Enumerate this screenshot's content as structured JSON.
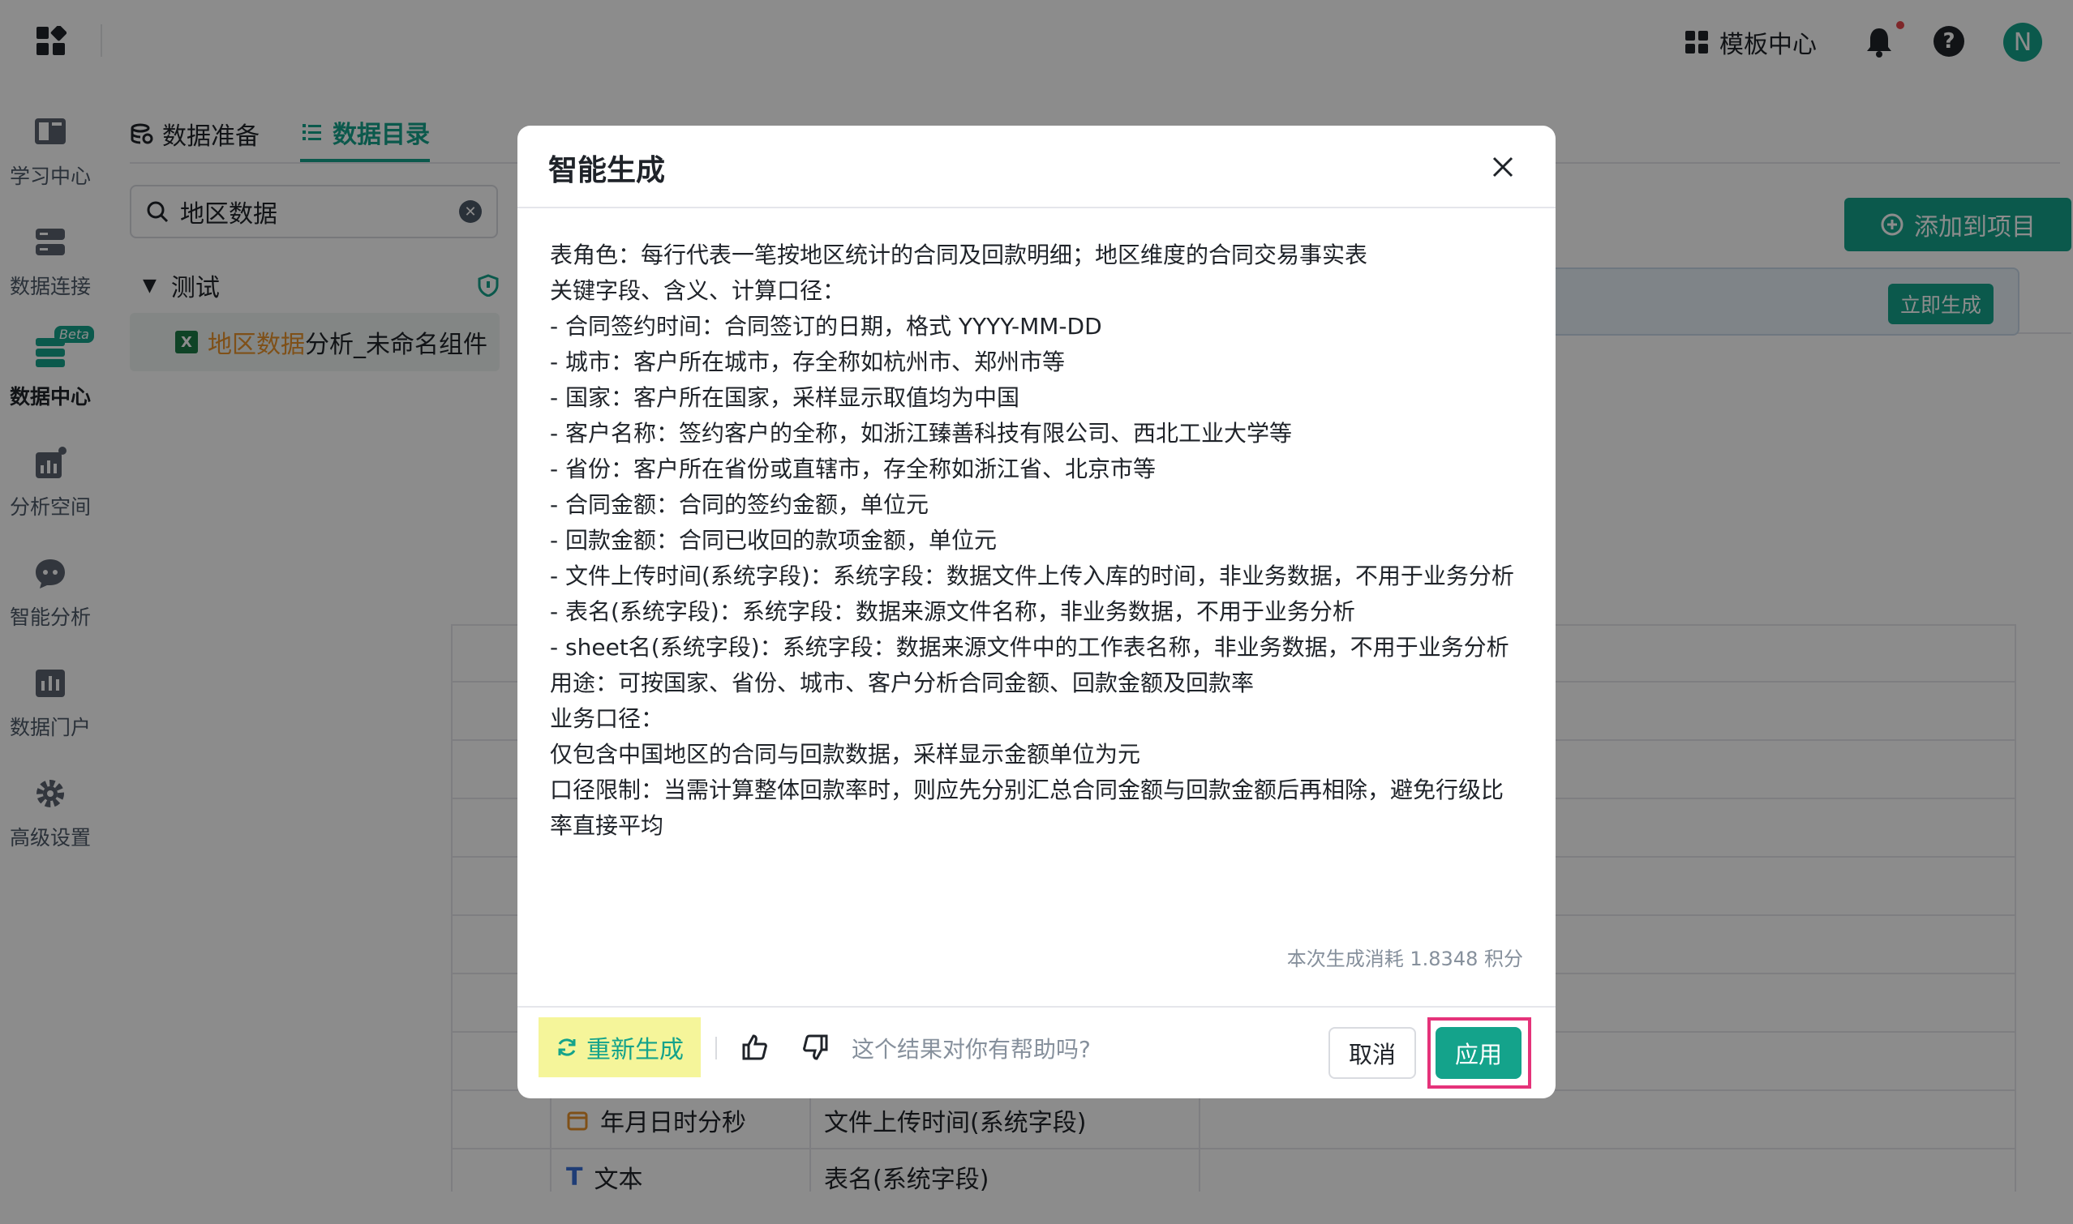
{
  "topbar": {
    "template_center": "模板中心",
    "avatar_letter": "N",
    "help_glyph": "?"
  },
  "nav": {
    "items": [
      {
        "label": "学习中心",
        "icon": "book-icon"
      },
      {
        "label": "数据连接",
        "icon": "database-icon"
      },
      {
        "label": "数据中心",
        "icon": "data-center-icon",
        "badge": "Beta",
        "active": true
      },
      {
        "label": "分析空间",
        "icon": "chart-icon"
      },
      {
        "label": "智能分析",
        "icon": "ai-chat-icon"
      },
      {
        "label": "数据门户",
        "icon": "portal-icon"
      },
      {
        "label": "高级设置",
        "icon": "gear-icon"
      }
    ]
  },
  "main": {
    "tabs": [
      {
        "label": "数据准备"
      },
      {
        "label": "数据目录",
        "active": true
      }
    ],
    "search_value": "地区数据",
    "tree": {
      "root": "测试",
      "leaf_highlight": "地区数据",
      "leaf_rest": "分析_未命名组件"
    },
    "add_to_project": "添加到项目",
    "generate_now": "立即生成",
    "table_rows": [
      {
        "type": "年月日时分秒",
        "name": "文件上传时间(系统字段)"
      },
      {
        "type": "文本",
        "name": "表名(系统字段)"
      }
    ]
  },
  "modal": {
    "title": "智能生成",
    "lines": [
      "表角色：每行代表一笔按地区统计的合同及回款明细；地区维度的合同交易事实表",
      "关键字段、含义、计算口径：",
      " - 合同签约时间：合同签订的日期，格式 YYYY-MM-DD",
      " - 城市：客户所在城市，存全称如杭州市、郑州市等",
      " - 国家：客户所在国家，采样显示取值均为中国",
      " - 客户名称：签约客户的全称，如浙江臻善科技有限公司、西北工业大学等",
      " - 省份：客户所在省份或直辖市，存全称如浙江省、北京市等",
      " - 合同金额：合同的签约金额，单位元",
      " - 回款金额：合同已收回的款项金额，单位元",
      " - 文件上传时间(系统字段)：系统字段：数据文件上传入库的时间，非业务数据，不用于业务分析",
      " - 表名(系统字段)：系统字段：数据来源文件名称，非业务数据，不用于业务分析",
      " - sheet名(系统字段)：系统字段：数据来源文件中的工作表名称，非业务数据，不用于业务分析",
      "用途：可按国家、省份、城市、客户分析合同金额、回款金额及回款率",
      "业务口径：",
      "仅包含中国地区的合同与回款数据，采样显示金额单位为元",
      "口径限制：当需计算整体回款率时，则应先分别汇总合同金额与回款金额后再相除，避免行级比",
      "率直接平均"
    ],
    "cost": "本次生成消耗 1.8348 积分",
    "regenerate": "重新生成",
    "helpful_question": "这个结果对你有帮助吗?",
    "cancel": "取消",
    "apply": "应用"
  },
  "colors": {
    "accent": "#14a38b",
    "highlight_yellow": "#f5f59a",
    "highlight_pink": "#e5337a",
    "search_match": "#e8932d"
  }
}
